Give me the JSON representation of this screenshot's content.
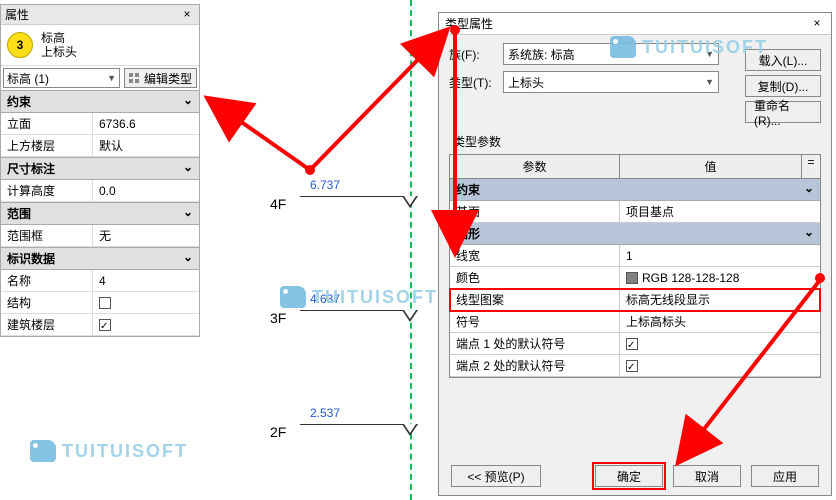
{
  "prop": {
    "title": "属性",
    "type_main": "标高",
    "type_sub": "上标头",
    "selector": "标高 (1)",
    "edit_type": "编辑类型",
    "badge": "3",
    "sections": {
      "constraint": "约束",
      "dim": "尺寸标注",
      "extent": "范围",
      "ident": "标识数据"
    },
    "rows": {
      "elevation_k": "立面",
      "elevation_v": "6736.6",
      "upper_k": "上方楼层",
      "upper_v": "默认",
      "calc_k": "计算高度",
      "calc_v": "0.0",
      "scope_k": "范围框",
      "scope_v": "无",
      "name_k": "名称",
      "name_v": "4",
      "struct_k": "结构",
      "bstory_k": "建筑楼层"
    }
  },
  "levels": {
    "l4_name": "4F",
    "l4_val": "6.737",
    "l3_name": "3F",
    "l3_val": "4.637",
    "l2_name": "2F",
    "l2_val": "2.537"
  },
  "dialog": {
    "title": "类型属性",
    "family_lbl": "族(F):",
    "family_val": "系统族: 标高",
    "type_lbl": "类型(T):",
    "type_val": "上标头",
    "load_btn": "载入(L)...",
    "copy_btn": "复制(D)...",
    "rename_btn": "重命名(R)...",
    "params_label": "类型参数",
    "col_param": "参数",
    "col_value": "值",
    "col_eq": "=",
    "grp_constraint": "约束",
    "row_base_k": "基面",
    "row_base_v": "项目基点",
    "grp_graphics": "图形",
    "row_weight_k": "线宽",
    "row_weight_v": "1",
    "row_color_k": "颜色",
    "row_color_v": "RGB 128-128-128",
    "row_pattern_k": "线型图案",
    "row_pattern_v": "标高无线段显示",
    "row_symbol_k": "符号",
    "row_symbol_v": "上标高标头",
    "row_end1_k": "端点 1 处的默认符号",
    "row_end2_k": "端点 2 处的默认符号",
    "btn_preview": "<< 预览(P)",
    "btn_ok": "确定",
    "btn_cancel": "取消",
    "btn_apply": "应用"
  },
  "watermark": "TUITUISOFT"
}
